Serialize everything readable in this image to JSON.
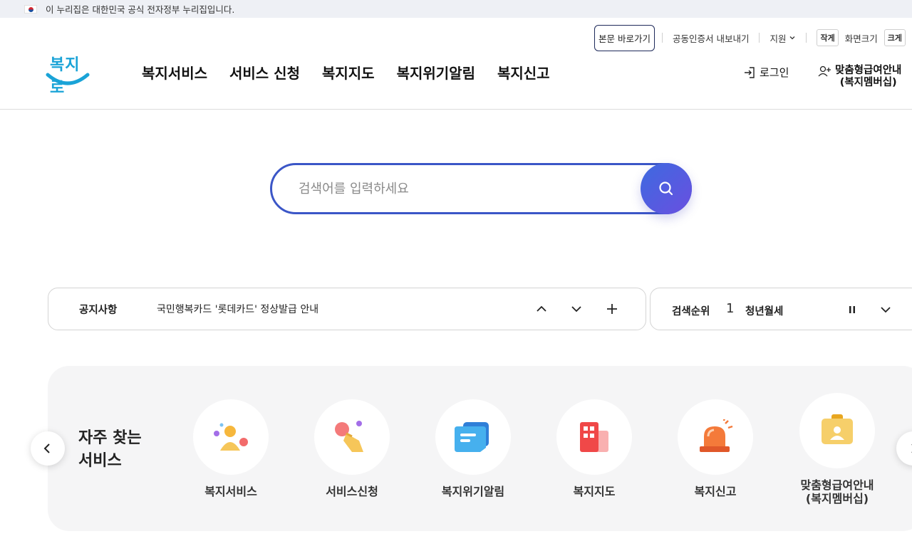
{
  "gov_banner": {
    "text": "이 누리집은 대한민국 공식 전자정부 누리집입니다."
  },
  "header": {
    "logo_text": "복지로",
    "util": {
      "skip": "본문 바로가기",
      "cert": "공동인증서 내보내기",
      "support": "지원",
      "small": "작게",
      "size": "화면크기",
      "large": "크게"
    },
    "nav": [
      "복지서비스",
      "서비스 신청",
      "복지지도",
      "복지위기알림",
      "복지신고"
    ],
    "login": "로그인",
    "member_line1": "맞춤형급여안내",
    "member_line2": "(복지멤버십)"
  },
  "search": {
    "placeholder": "검색어를 입력하세요"
  },
  "notice": {
    "label": "공지사항",
    "text": "국민행복카드 '롯데카드' 정상발급 안내"
  },
  "rank": {
    "label": "검색순위",
    "num": "1",
    "keyword": "청년월세"
  },
  "frequent": {
    "title_line1": "자주 찾는",
    "title_line2": "서비스",
    "items": [
      {
        "name": "복지서비스",
        "icon": "person-icon"
      },
      {
        "name": "서비스신청",
        "icon": "hand-tap-icon"
      },
      {
        "name": "복지위기알림",
        "icon": "chat-icon"
      },
      {
        "name": "복지지도",
        "icon": "building-icon"
      },
      {
        "name": "복지신고",
        "icon": "siren-icon"
      },
      {
        "name1": "맞춤형급여안내",
        "name2": "(복지멤버십)",
        "icon": "id-card-icon"
      }
    ]
  },
  "colors": {
    "accent": "#3b56c7",
    "logo": "#1aa3d7",
    "panel": "#f5f5f6"
  }
}
